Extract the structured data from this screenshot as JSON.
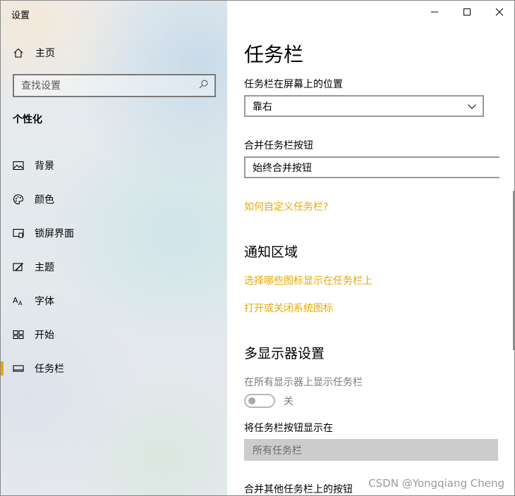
{
  "window": {
    "title": "设置"
  },
  "sidebar": {
    "home_label": "主页",
    "search_placeholder": "查找设置",
    "section_title": "个性化",
    "items": [
      {
        "label": "背景",
        "icon": "picture-icon",
        "active": false
      },
      {
        "label": "颜色",
        "icon": "palette-icon",
        "active": false
      },
      {
        "label": "锁屏界面",
        "icon": "lock-screen-icon",
        "active": false
      },
      {
        "label": "主题",
        "icon": "theme-icon",
        "active": false
      },
      {
        "label": "字体",
        "icon": "font-icon",
        "active": false
      },
      {
        "label": "开始",
        "icon": "start-icon",
        "active": false
      },
      {
        "label": "任务栏",
        "icon": "taskbar-icon",
        "active": true
      }
    ],
    "accent_color": "#e9a800"
  },
  "content": {
    "page_title": "任务栏",
    "position": {
      "label": "任务栏在屏幕上的位置",
      "value": "靠右"
    },
    "combine": {
      "label": "合并任务栏按钮",
      "value": "始终合并按钮"
    },
    "customize_link": "如何自定义任务栏?",
    "notify_section": {
      "heading": "通知区域",
      "link1": "选择哪些图标显示在任务栏上",
      "link2": "打开或关闭系统图标"
    },
    "multi_section": {
      "heading": "多显示器设置",
      "show_all_label": "在所有显示器上显示任务栏",
      "toggle_state": "关",
      "toggle_on": false,
      "buttons_on_label": "将任务栏按钮显示在",
      "buttons_on_value": "所有任务栏",
      "combine_other_label": "合并其他任务栏上的按钮"
    },
    "link_color": "#e9a800"
  },
  "watermark": "CSDN @Yongqiang Cheng"
}
